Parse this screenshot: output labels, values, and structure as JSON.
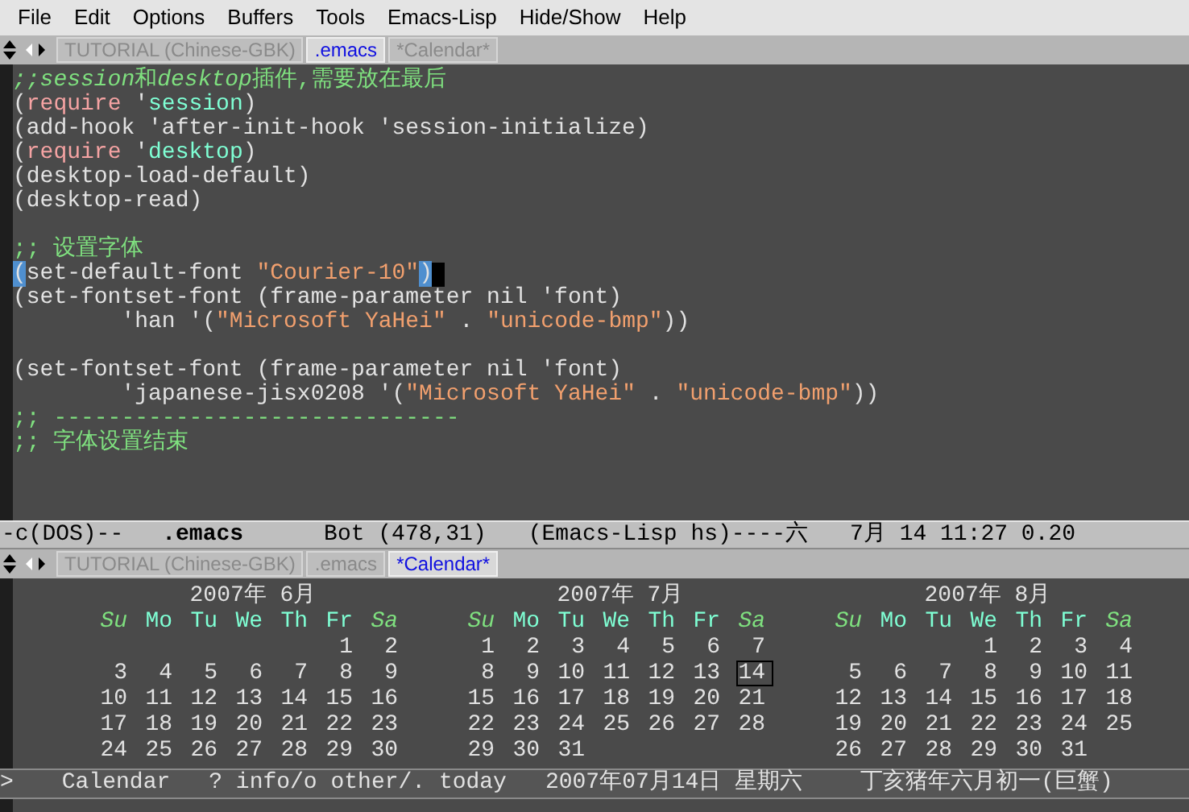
{
  "menu_bar": [
    "File",
    "Edit",
    "Options",
    "Buffers",
    "Tools",
    "Emacs-Lisp",
    "Hide/Show",
    "Help"
  ],
  "top_tabs": [
    {
      "label": "TUTORIAL (Chinese-GBK)",
      "selected": false
    },
    {
      "label": ".emacs",
      "selected": true
    },
    {
      "label": "*Calendar*",
      "selected": false
    }
  ],
  "editor": {
    "lines": [
      {
        "kind": "code",
        "cursor": false,
        "segments": [
          {
            "kind": "comment-italic",
            "text": ";;session"
          },
          {
            "kind": "comment",
            "text": "和"
          },
          {
            "kind": "comment-italic",
            "text": "desktop"
          },
          {
            "kind": "comment",
            "text": "插件,需要放在最后"
          }
        ]
      },
      {
        "kind": "code",
        "cursor": false,
        "segments": [
          {
            "kind": "plain",
            "text": "("
          },
          {
            "kind": "keyword",
            "text": "require"
          },
          {
            "kind": "plain",
            "text": " '"
          },
          {
            "kind": "constant",
            "text": "session"
          },
          {
            "kind": "plain",
            "text": ")"
          }
        ]
      },
      {
        "kind": "code",
        "cursor": false,
        "segments": [
          {
            "kind": "plain",
            "text": "(add-hook 'after-init-hook 'session-initialize)"
          }
        ]
      },
      {
        "kind": "code",
        "cursor": false,
        "segments": [
          {
            "kind": "plain",
            "text": "("
          },
          {
            "kind": "keyword",
            "text": "require"
          },
          {
            "kind": "plain",
            "text": " '"
          },
          {
            "kind": "constant",
            "text": "desktop"
          },
          {
            "kind": "plain",
            "text": ")"
          }
        ]
      },
      {
        "kind": "code",
        "cursor": false,
        "segments": [
          {
            "kind": "plain",
            "text": "(desktop-load-default)"
          }
        ]
      },
      {
        "kind": "code",
        "cursor": false,
        "segments": [
          {
            "kind": "plain",
            "text": "(desktop-read)"
          }
        ]
      },
      {
        "kind": "blank"
      },
      {
        "kind": "code",
        "cursor": false,
        "segments": [
          {
            "kind": "comment",
            "text": ";; 设置字体"
          }
        ]
      },
      {
        "kind": "code",
        "cursor": true,
        "segments": [
          {
            "kind": "paren-match",
            "text": "("
          },
          {
            "kind": "plain",
            "text": "set-default-font "
          },
          {
            "kind": "string",
            "text": "\"Courier-10\""
          },
          {
            "kind": "paren-match",
            "text": ")"
          }
        ]
      },
      {
        "kind": "code",
        "cursor": false,
        "segments": [
          {
            "kind": "plain",
            "text": "(set-fontset-font (frame-parameter nil 'font)"
          }
        ]
      },
      {
        "kind": "code",
        "cursor": false,
        "segments": [
          {
            "kind": "plain",
            "text": "        'han '("
          },
          {
            "kind": "string",
            "text": "\"Microsoft YaHei\""
          },
          {
            "kind": "plain",
            "text": " . "
          },
          {
            "kind": "string",
            "text": "\"unicode-bmp\""
          },
          {
            "kind": "plain",
            "text": "))"
          }
        ]
      },
      {
        "kind": "blank"
      },
      {
        "kind": "code",
        "cursor": false,
        "segments": [
          {
            "kind": "plain",
            "text": "(set-fontset-font (frame-parameter nil 'font)"
          }
        ]
      },
      {
        "kind": "code",
        "cursor": false,
        "segments": [
          {
            "kind": "plain",
            "text": "        'japanese-jisx0208 '("
          },
          {
            "kind": "string",
            "text": "\"Microsoft YaHei\""
          },
          {
            "kind": "plain",
            "text": " . "
          },
          {
            "kind": "string",
            "text": "\"unicode-bmp\""
          },
          {
            "kind": "plain",
            "text": "))"
          }
        ]
      },
      {
        "kind": "code",
        "cursor": false,
        "segments": [
          {
            "kind": "comment",
            "text": ";; ------------------------------"
          }
        ]
      },
      {
        "kind": "code",
        "cursor": false,
        "segments": [
          {
            "kind": "comment",
            "text": ";; 字体设置结束"
          }
        ]
      }
    ]
  },
  "mode_line": [
    {
      "kind": "status",
      "text": "-c(DOS)--"
    },
    {
      "kind": "buffer",
      "text": ".emacs"
    },
    {
      "kind": "status",
      "text": "Bot (478,31)"
    },
    {
      "kind": "status",
      "text": "(Emacs-Lisp hs)----六"
    },
    {
      "kind": "status",
      "text": "7月 14 11:27 0.20"
    }
  ],
  "bottom_tabs": [
    {
      "label": "TUTORIAL (Chinese-GBK)",
      "selected": false
    },
    {
      "label": ".emacs",
      "selected": false
    },
    {
      "label": "*Calendar*",
      "selected": true
    }
  ],
  "calendar": {
    "months": [
      {
        "title": "2007年 6月",
        "weekdays": [
          "Su",
          "Mo",
          "Tu",
          "We",
          "Th",
          "Fr",
          "Sa"
        ],
        "weeks": [
          [
            {
              "d": "1",
              "selected": false
            },
            {
              "d": "2",
              "selected": false
            }
          ],
          [
            {
              "d": "3",
              "selected": false
            },
            {
              "d": "4",
              "selected": false
            },
            {
              "d": "5",
              "selected": false
            },
            {
              "d": "6",
              "selected": false
            },
            {
              "d": "7",
              "selected": false
            },
            {
              "d": "8",
              "selected": false
            },
            {
              "d": "9",
              "selected": false
            }
          ],
          [
            {
              "d": "10",
              "selected": false
            },
            {
              "d": "11",
              "selected": false
            },
            {
              "d": "12",
              "selected": false
            },
            {
              "d": "13",
              "selected": false
            },
            {
              "d": "14",
              "selected": false
            },
            {
              "d": "15",
              "selected": false
            },
            {
              "d": "16",
              "selected": false
            }
          ],
          [
            {
              "d": "17",
              "selected": false
            },
            {
              "d": "18",
              "selected": false
            },
            {
              "d": "19",
              "selected": false
            },
            {
              "d": "20",
              "selected": false
            },
            {
              "d": "21",
              "selected": false
            },
            {
              "d": "22",
              "selected": false
            },
            {
              "d": "23",
              "selected": false
            }
          ],
          [
            {
              "d": "24",
              "selected": false
            },
            {
              "d": "25",
              "selected": false
            },
            {
              "d": "26",
              "selected": false
            },
            {
              "d": "27",
              "selected": false
            },
            {
              "d": "28",
              "selected": false
            },
            {
              "d": "29",
              "selected": false
            },
            {
              "d": "30",
              "selected": false
            }
          ]
        ]
      },
      {
        "title": "2007年 7月",
        "weekdays": [
          "Su",
          "Mo",
          "Tu",
          "We",
          "Th",
          "Fr",
          "Sa"
        ],
        "weeks": [
          [
            {
              "d": "1",
              "selected": false
            },
            {
              "d": "2",
              "selected": false
            },
            {
              "d": "3",
              "selected": false
            },
            {
              "d": "4",
              "selected": false
            },
            {
              "d": "5",
              "selected": false
            },
            {
              "d": "6",
              "selected": false
            },
            {
              "d": "7",
              "selected": false
            }
          ],
          [
            {
              "d": "8",
              "selected": false
            },
            {
              "d": "9",
              "selected": false
            },
            {
              "d": "10",
              "selected": false
            },
            {
              "d": "11",
              "selected": false
            },
            {
              "d": "12",
              "selected": false
            },
            {
              "d": "13",
              "selected": false
            },
            {
              "d": "14",
              "selected": true
            }
          ],
          [
            {
              "d": "15",
              "selected": false
            },
            {
              "d": "16",
              "selected": false
            },
            {
              "d": "17",
              "selected": false
            },
            {
              "d": "18",
              "selected": false
            },
            {
              "d": "19",
              "selected": false
            },
            {
              "d": "20",
              "selected": false
            },
            {
              "d": "21",
              "selected": false
            }
          ],
          [
            {
              "d": "22",
              "selected": false
            },
            {
              "d": "23",
              "selected": false
            },
            {
              "d": "24",
              "selected": false
            },
            {
              "d": "25",
              "selected": false
            },
            {
              "d": "26",
              "selected": false
            },
            {
              "d": "27",
              "selected": false
            },
            {
              "d": "28",
              "selected": false
            }
          ],
          [
            {
              "d": "29",
              "selected": false
            },
            {
              "d": "30",
              "selected": false
            },
            {
              "d": "31",
              "selected": false
            }
          ]
        ]
      },
      {
        "title": "2007年 8月",
        "weekdays": [
          "Su",
          "Mo",
          "Tu",
          "We",
          "Th",
          "Fr",
          "Sa"
        ],
        "weeks": [
          [
            {
              "d": "1",
              "selected": false
            },
            {
              "d": "2",
              "selected": false
            },
            {
              "d": "3",
              "selected": false
            },
            {
              "d": "4",
              "selected": false
            }
          ],
          [
            {
              "d": "5",
              "selected": false
            },
            {
              "d": "6",
              "selected": false
            },
            {
              "d": "7",
              "selected": false
            },
            {
              "d": "8",
              "selected": false
            },
            {
              "d": "9",
              "selected": false
            },
            {
              "d": "10",
              "selected": false
            },
            {
              "d": "11",
              "selected": false
            }
          ],
          [
            {
              "d": "12",
              "selected": false
            },
            {
              "d": "13",
              "selected": false
            },
            {
              "d": "14",
              "selected": false
            },
            {
              "d": "15",
              "selected": false
            },
            {
              "d": "16",
              "selected": false
            },
            {
              "d": "17",
              "selected": false
            },
            {
              "d": "18",
              "selected": false
            }
          ],
          [
            {
              "d": "19",
              "selected": false
            },
            {
              "d": "20",
              "selected": false
            },
            {
              "d": "21",
              "selected": false
            },
            {
              "d": "22",
              "selected": false
            },
            {
              "d": "23",
              "selected": false
            },
            {
              "d": "24",
              "selected": false
            },
            {
              "d": "25",
              "selected": false
            }
          ],
          [
            {
              "d": "26",
              "selected": false
            },
            {
              "d": "27",
              "selected": false
            },
            {
              "d": "28",
              "selected": false
            },
            {
              "d": "29",
              "selected": false
            },
            {
              "d": "30",
              "selected": false
            },
            {
              "d": "31",
              "selected": false
            }
          ]
        ]
      }
    ]
  },
  "calendar_mode_line": [
    ">",
    "Calendar",
    "? info/o other/. today",
    "2007年07月14日 星期六",
    "丁亥猪年六月初一(巨蟹)"
  ]
}
